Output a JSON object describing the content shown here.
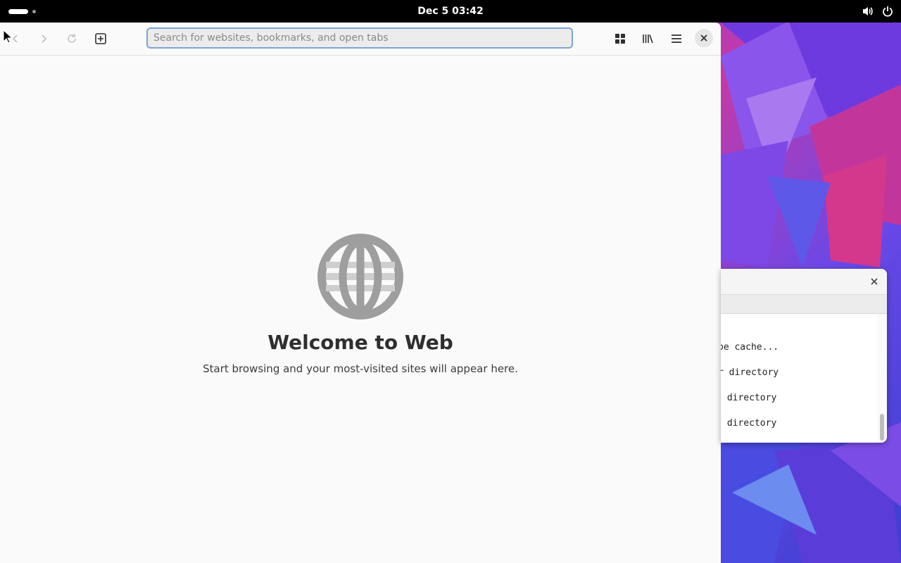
{
  "topbar": {
    "clock": "Dec 5  03:42",
    "icons": [
      "volume-icon",
      "power-icon"
    ]
  },
  "browser": {
    "toolbar": {
      "back_icon": "chevron-left-icon",
      "forward_icon": "chevron-right-icon",
      "reload_icon": "reload-icon",
      "new_tab_icon": "new-tab-icon",
      "overview_icon": "tabs-overview-icon",
      "library_icon": "library-icon",
      "menu_icon": "hamburger-menu-icon",
      "close_icon": "close-icon"
    },
    "url_bar": {
      "value": "",
      "placeholder": "Search for websites, bookmarks, and open tabs"
    },
    "welcome": {
      "icon": "globe-icon",
      "title": "Welcome to Web",
      "subtitle": "Start browsing and your most-visited sites will appear here."
    }
  },
  "terminal": {
    "lines": [
      "pe cache...",
      "r directory",
      " directory",
      " directory"
    ]
  },
  "colors": {
    "topbar_bg": "#000000",
    "browser_bg": "#fafafa",
    "url_focus_border": "#7aa4d8",
    "globe": "#9e9e9e"
  }
}
